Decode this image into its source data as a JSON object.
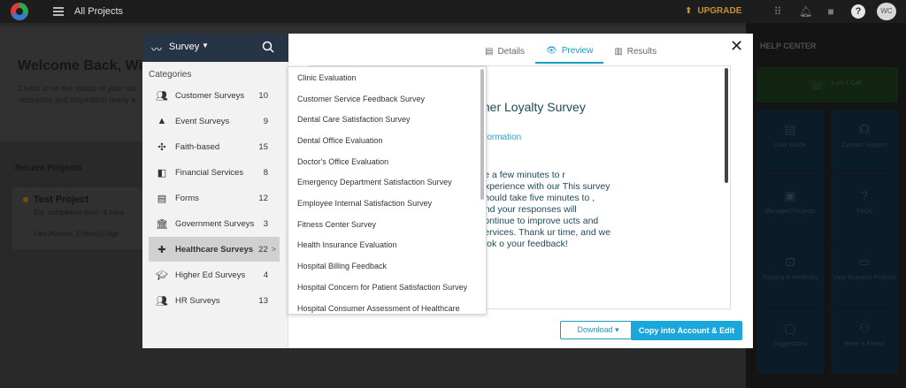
{
  "topbar": {
    "title": "All Projects",
    "upgrade": "UPGRADE",
    "avatar": "WC"
  },
  "background": {
    "welcome_title": "Welcome Back, Wil",
    "welcome_text": "Check in on the status of your mo resources and inspiration ready a",
    "recent_title": "Recent Projects",
    "project_title": "Test Project",
    "project_line1": "Est. completion time : 4 mins",
    "project_line2": "Last Access: 2 Hour(s) Ago"
  },
  "help": {
    "title": "HELP CENTER",
    "call": "1-on-1 Call",
    "tiles": [
      "User Guide",
      "Contact Support",
      "Managed Projects",
      "FAQs",
      "Training & Webinars",
      "View Example Projects",
      "Suggestions",
      "Refer a Friend"
    ]
  },
  "modal": {
    "survey_label": "Survey",
    "categories_title": "Categories",
    "categories": [
      {
        "name": "Customer Surveys",
        "count": "10"
      },
      {
        "name": "Event Surveys",
        "count": "9"
      },
      {
        "name": "Faith-based",
        "count": "15"
      },
      {
        "name": "Financial Services",
        "count": "8"
      },
      {
        "name": "Forms",
        "count": "12"
      },
      {
        "name": "Government Surveys",
        "count": "3"
      },
      {
        "name": "Healthcare Surveys",
        "count": "22"
      },
      {
        "name": "Higher Ed Surveys",
        "count": "4"
      },
      {
        "name": "HR Surveys",
        "count": "13"
      }
    ],
    "tabs": {
      "details": "Details",
      "preview": "Preview",
      "results": "Results"
    },
    "preview": {
      "title": "mer Loyalty Survey",
      "subtitle": "nformation",
      "body": "ke a few minutes to r experience with our This survey should take five minutes to , and your responses will continue to improve ucts and services. Thank ur time, and we look o your feedback!"
    },
    "download": "Download ▾",
    "copy": "Copy into Account & Edit"
  },
  "dropdown": {
    "items": [
      "Clinic Evaluation",
      "Customer Service Feedback Survey",
      "Dental Care Satisfaction Survey",
      "Dental Office Evaluation",
      "Doctor's Office Evaluation",
      "Emergency Department Satisfaction Survey",
      "Employee Internal Satisfaction Survey",
      "Fitness Center Survey",
      "Health Insurance Evaluation",
      "Hospital Billing Feedback",
      "Hospital Concern for Patient Satisfaction Survey",
      "Hospital Consumer Assessment of Healthcare"
    ]
  }
}
